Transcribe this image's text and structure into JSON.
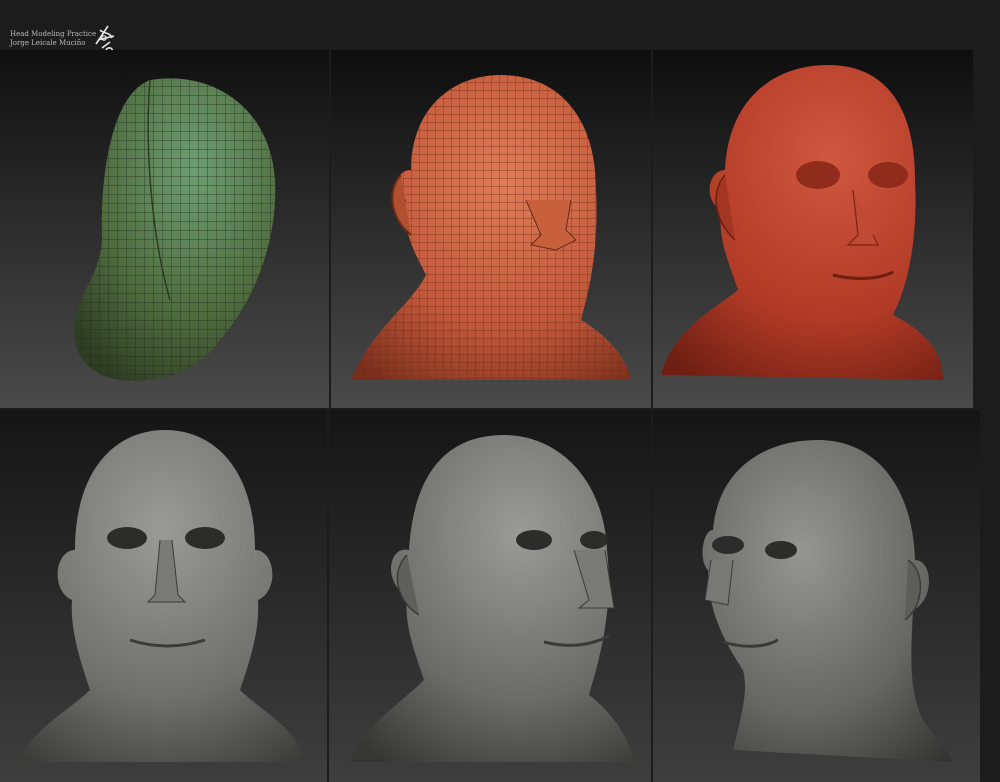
{
  "header": {
    "line1": "Head Modeling Practice",
    "line2": "Jorge Leicale Muciño",
    "logo_icon": "signature-logo-icon"
  },
  "panels": [
    {
      "name": "panel-base-mesh",
      "stage": "base-mesh",
      "color": "#4f6c3f"
    },
    {
      "name": "panel-subdivided-mesh",
      "stage": "subdivided-mesh",
      "color": "#c2583a"
    },
    {
      "name": "panel-sculpted-red",
      "stage": "sculpted",
      "color": "#b13a26"
    },
    {
      "name": "panel-detail-front",
      "stage": "detail-front",
      "color": "#6f6f6c"
    },
    {
      "name": "panel-detail-three-quarter",
      "stage": "detail-three-quarter",
      "color": "#6b6b68"
    },
    {
      "name": "panel-detail-side",
      "stage": "detail-side",
      "color": "#656562"
    }
  ]
}
